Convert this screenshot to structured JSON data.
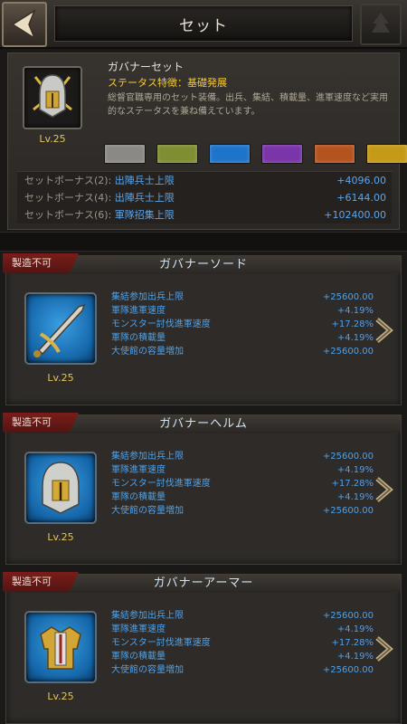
{
  "header": {
    "title": "セット"
  },
  "set": {
    "name": "ガバナーセット",
    "trait": "ステータス特徴：基礎発展",
    "description": "総督官職専用のセット装備。出兵、集結、積載量、進軍速度など実用的なステータスを兼ね備えています。",
    "level": "Lv.25",
    "swatches": [
      "#8a8985",
      "#7f8e32",
      "#1e74c9",
      "#7a35a8",
      "#b5531f",
      "#c59a18"
    ],
    "bonuses": [
      {
        "label_a": "セットボーナス(2): ",
        "label_b": "出陣兵士上限",
        "value": "+4096.00"
      },
      {
        "label_a": "セットボーナス(4): ",
        "label_b": "出陣兵士上限",
        "value": "+6144.00"
      },
      {
        "label_a": "セットボーナス(6): ",
        "label_b": "軍隊招集上限",
        "value": "+102400.00"
      }
    ]
  },
  "items": [
    {
      "ribbon": "製造不可",
      "name": "ガバナーソード",
      "level": "Lv.25",
      "stats": [
        {
          "label": "集結参加出兵上限",
          "value": "+25600.00"
        },
        {
          "label": "軍隊進軍速度",
          "value": "+4.19%"
        },
        {
          "label": "モンスター討伐進軍速度",
          "value": "+17.28%"
        },
        {
          "label": "軍隊の積載量",
          "value": "+4.19%"
        },
        {
          "label": "大使館の容量増加",
          "value": "+25600.00"
        }
      ]
    },
    {
      "ribbon": "製造不可",
      "name": "ガバナーヘルム",
      "level": "Lv.25",
      "stats": [
        {
          "label": "集結参加出兵上限",
          "value": "+25600.00"
        },
        {
          "label": "軍隊進軍速度",
          "value": "+4.19%"
        },
        {
          "label": "モンスター討伐進軍速度",
          "value": "+17.28%"
        },
        {
          "label": "軍隊の積載量",
          "value": "+4.19%"
        },
        {
          "label": "大使館の容量増加",
          "value": "+25600.00"
        }
      ]
    },
    {
      "ribbon": "製造不可",
      "name": "ガバナーアーマー",
      "level": "Lv.25",
      "stats": [
        {
          "label": "集結参加出兵上限",
          "value": "+25600.00"
        },
        {
          "label": "軍隊進軍速度",
          "value": "+4.19%"
        },
        {
          "label": "モンスター討伐進軍速度",
          "value": "+17.28%"
        },
        {
          "label": "軍隊の積載量",
          "value": "+4.19%"
        },
        {
          "label": "大使館の容量増加",
          "value": "+25600.00"
        }
      ]
    }
  ]
}
